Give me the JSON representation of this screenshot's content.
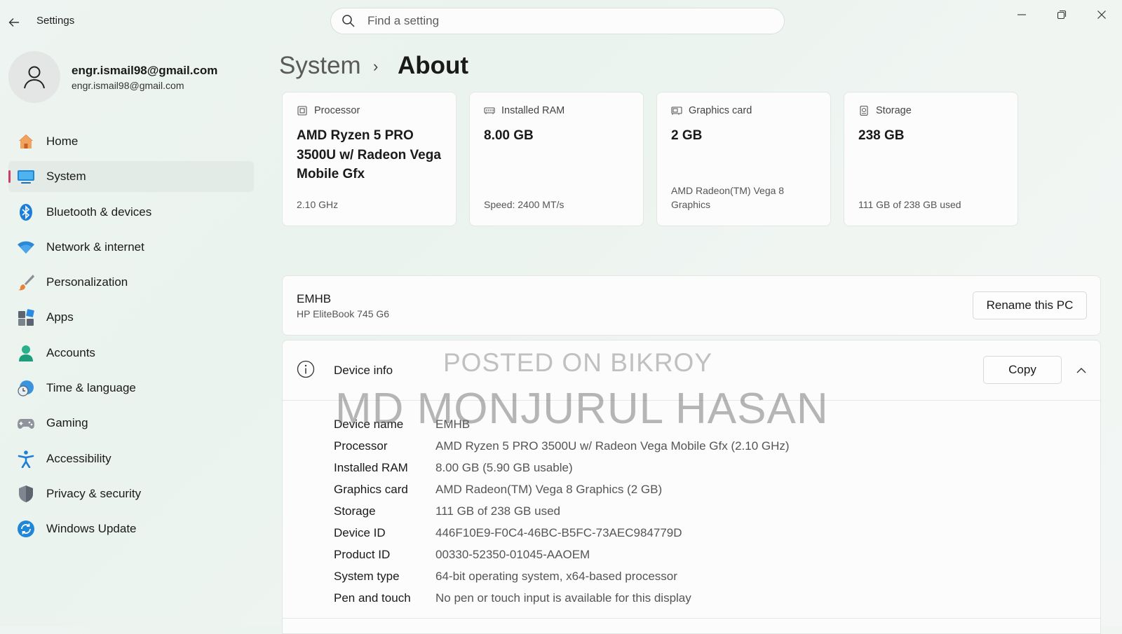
{
  "window": {
    "title": "Settings",
    "search_placeholder": "Find a setting"
  },
  "profile": {
    "name": "engr.ismail98@gmail.com",
    "email": "engr.ismail98@gmail.com"
  },
  "nav": {
    "items": [
      {
        "label": "Home",
        "icon": "home-icon"
      },
      {
        "label": "System",
        "icon": "system-icon",
        "active": true
      },
      {
        "label": "Bluetooth & devices",
        "icon": "bluetooth-icon"
      },
      {
        "label": "Network & internet",
        "icon": "wifi-icon"
      },
      {
        "label": "Personalization",
        "icon": "brush-icon"
      },
      {
        "label": "Apps",
        "icon": "apps-icon"
      },
      {
        "label": "Accounts",
        "icon": "accounts-icon"
      },
      {
        "label": "Time & language",
        "icon": "clock-globe-icon"
      },
      {
        "label": "Gaming",
        "icon": "gamepad-icon"
      },
      {
        "label": "Accessibility",
        "icon": "accessibility-icon"
      },
      {
        "label": "Privacy & security",
        "icon": "shield-icon"
      },
      {
        "label": "Windows Update",
        "icon": "update-icon"
      }
    ]
  },
  "breadcrumb": {
    "parent": "System",
    "separator": "›",
    "current": "About"
  },
  "cards": [
    {
      "header": "Processor",
      "value": "AMD Ryzen 5 PRO 3500U w/ Radeon Vega Mobile Gfx",
      "sub": "2.10 GHz",
      "icon": "processor-icon"
    },
    {
      "header": "Installed RAM",
      "value": "8.00 GB",
      "sub": "Speed: 2400 MT/s",
      "icon": "ram-icon"
    },
    {
      "header": "Graphics card",
      "value": "2 GB",
      "sub": "AMD Radeon(TM) Vega 8 Graphics",
      "icon": "graphics-card-icon"
    },
    {
      "header": "Storage",
      "value": "238 GB",
      "sub": "111 GB of 238 GB used",
      "icon": "storage-icon"
    }
  ],
  "pc": {
    "name": "EMHB",
    "model": "HP EliteBook 745 G6",
    "rename_label": "Rename this PC"
  },
  "device_info": {
    "title": "Device info",
    "copy_label": "Copy",
    "rows": [
      {
        "key": "Device name",
        "value": "EMHB"
      },
      {
        "key": "Processor",
        "value": "AMD Ryzen 5 PRO 3500U w/ Radeon Vega Mobile Gfx (2.10 GHz)"
      },
      {
        "key": "Installed RAM",
        "value": "8.00 GB (5.90 GB usable)"
      },
      {
        "key": "Graphics card",
        "value": "AMD Radeon(TM) Vega 8 Graphics (2 GB)"
      },
      {
        "key": "Storage",
        "value": "111 GB of 238 GB used"
      },
      {
        "key": "Device ID",
        "value": "446F10E9-F0C4-46BC-B5FC-73AEC984779D"
      },
      {
        "key": "Product ID",
        "value": "00330-52350-01045-AAOEM"
      },
      {
        "key": "System type",
        "value": "64-bit operating system, x64-based processor"
      },
      {
        "key": "Pen and touch",
        "value": "No pen or touch input is available for this display"
      }
    ]
  },
  "watermark": {
    "line1": "POSTED ON BIKROY",
    "line2": "MD MONJURUL HASAN"
  }
}
